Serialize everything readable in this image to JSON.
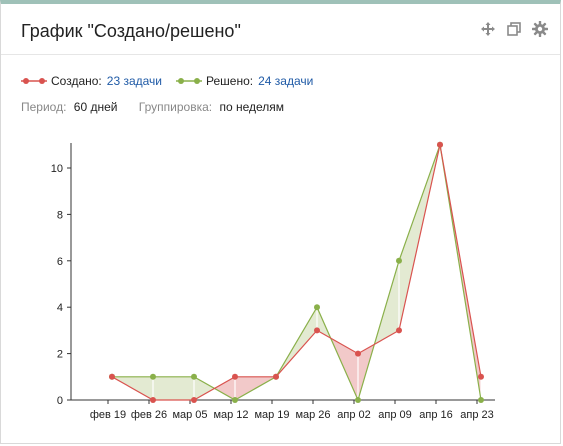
{
  "gadget": {
    "title": "График \"Создано/решено\"",
    "icons": [
      "move-icon",
      "popout-icon",
      "gear-icon"
    ]
  },
  "legend": {
    "created": {
      "label": "Создано:",
      "count_text": "23 задачи",
      "color": "#d9534f"
    },
    "resolved": {
      "label": "Решено:",
      "count_text": "24 задачи",
      "color": "#8ab04a"
    }
  },
  "meta": {
    "period_label": "Период:",
    "period_value": "60 дней",
    "grouping_label": "Группировка:",
    "grouping_value": "по неделям"
  },
  "chart_data": {
    "type": "line",
    "categories": [
      "фев 19",
      "фев 26",
      "мар 05",
      "мар 12",
      "мар 19",
      "мар 26",
      "апр 02",
      "апр 09",
      "апр 16",
      "апр 23"
    ],
    "series": [
      {
        "name": "Создано",
        "values": [
          1,
          0,
          0,
          1,
          1,
          3,
          2,
          3,
          11,
          1
        ],
        "color": "#d9534f"
      },
      {
        "name": "Решено",
        "values": [
          1,
          1,
          1,
          0,
          1,
          4,
          0,
          6,
          11,
          0
        ],
        "color": "#8ab04a"
      }
    ],
    "x_positions": [
      0,
      0.5,
      1,
      1.5,
      2,
      2.5,
      3,
      3.5,
      4,
      4.5
    ],
    "ylim": [
      0,
      11
    ],
    "yticks": [
      0,
      2,
      4,
      6,
      8,
      10
    ],
    "fill_colors": {
      "created_above": "#f2c9c9",
      "resolved_above": "#e3ead2"
    }
  }
}
